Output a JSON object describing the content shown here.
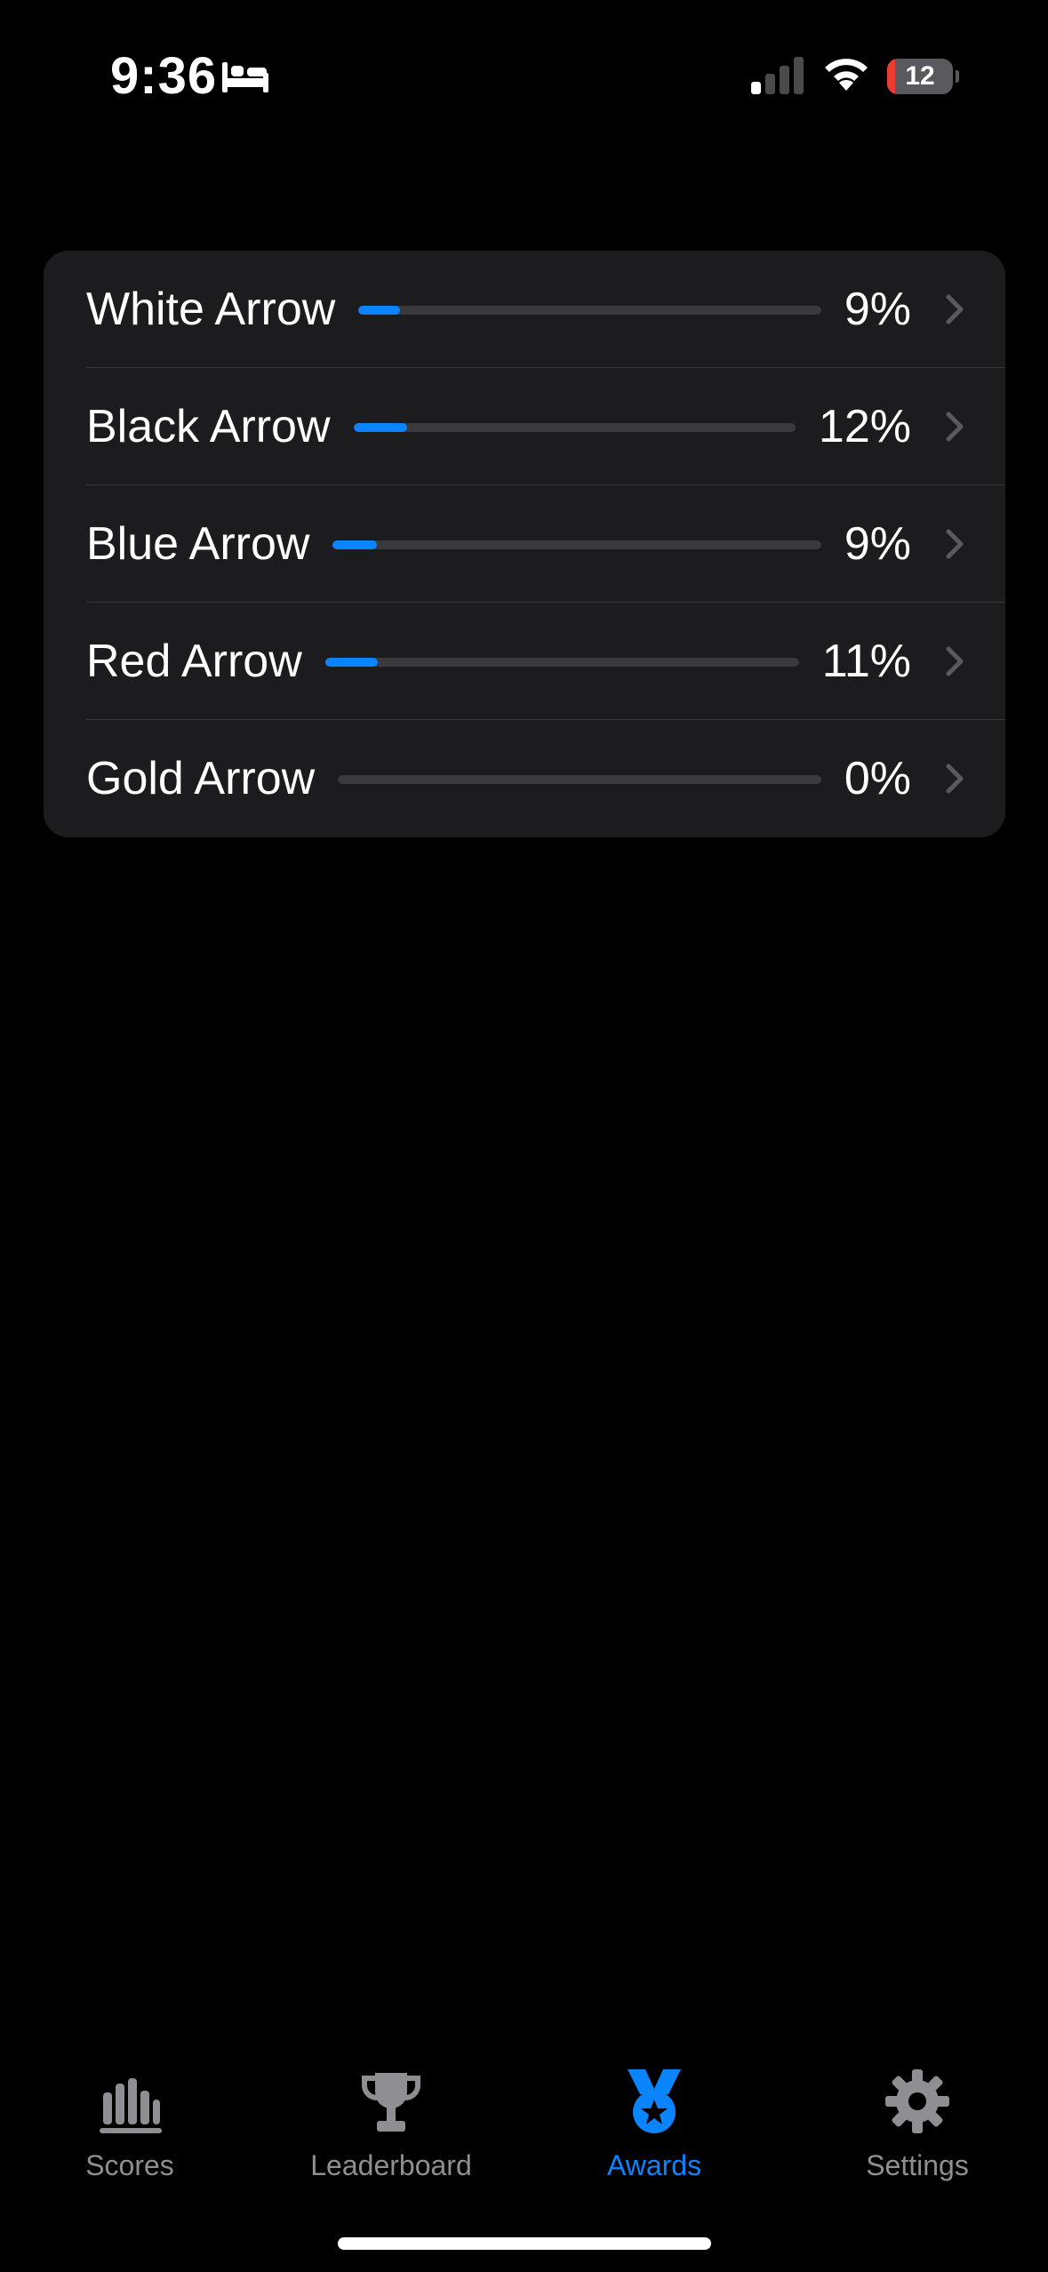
{
  "status_bar": {
    "time": "9:36",
    "focus_icon": "bed-icon",
    "battery_level": "12",
    "battery_fraction": 0.12,
    "colors": {
      "battery_low": "#eb3b32"
    }
  },
  "awards": {
    "items": [
      {
        "label": "White Arrow",
        "percent_text": "9%",
        "progress": 0.09
      },
      {
        "label": "Black Arrow",
        "percent_text": "12%",
        "progress": 0.12
      },
      {
        "label": "Blue Arrow",
        "percent_text": "9%",
        "progress": 0.09
      },
      {
        "label": "Red Arrow",
        "percent_text": "11%",
        "progress": 0.11
      },
      {
        "label": "Gold Arrow",
        "percent_text": "0%",
        "progress": 0.0
      }
    ]
  },
  "tab_bar": {
    "active": "Awards",
    "tabs": [
      {
        "label": "Scores",
        "icon": "chart-bar-icon"
      },
      {
        "label": "Leaderboard",
        "icon": "trophy-icon"
      },
      {
        "label": "Awards",
        "icon": "medal-icon"
      },
      {
        "label": "Settings",
        "icon": "gear-icon"
      }
    ]
  },
  "colors": {
    "accent": "#0a84ff",
    "card_background": "#1c1c1e",
    "track": "#3a3a3c",
    "inactive_tab": "#8e8e93"
  }
}
